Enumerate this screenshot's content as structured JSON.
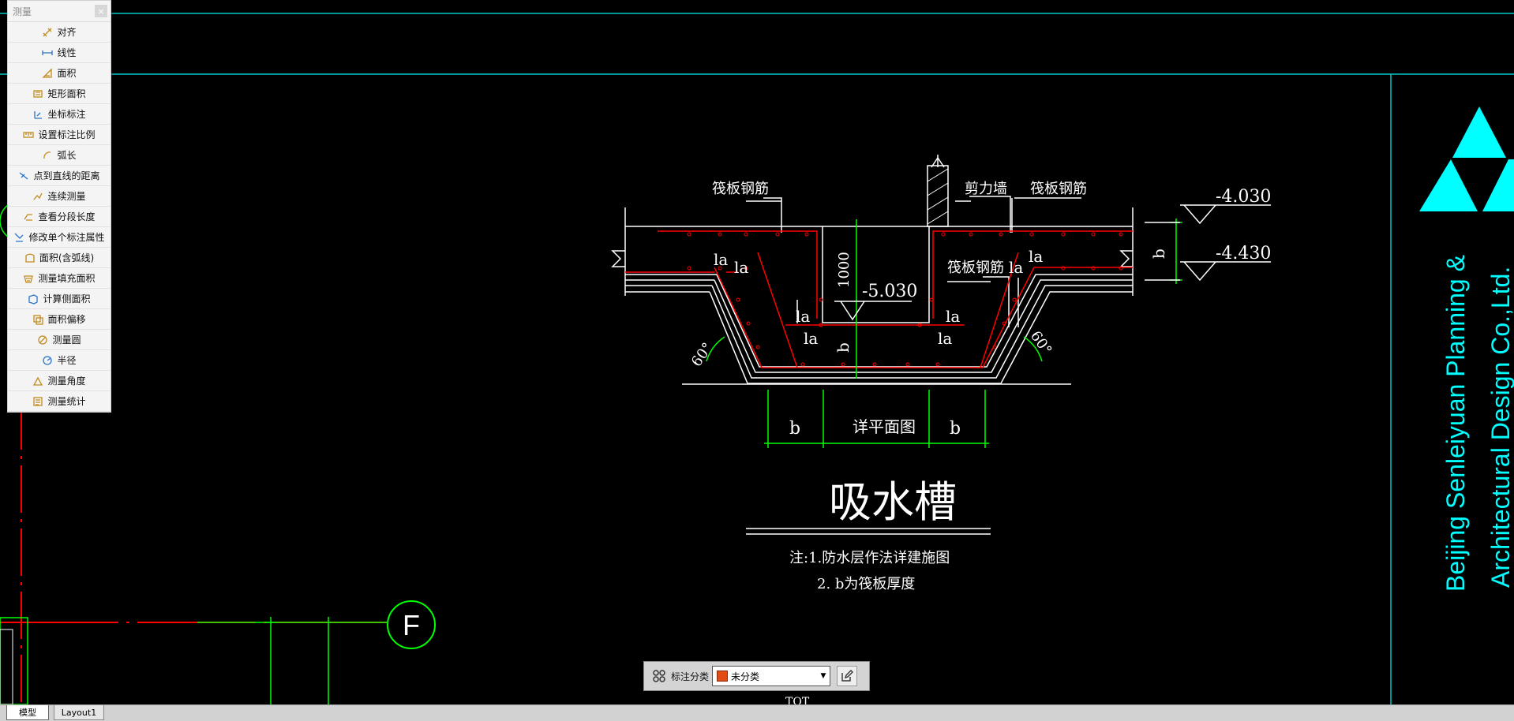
{
  "measure_panel": {
    "title": "测量",
    "close": "×",
    "items": [
      {
        "label": "对齐",
        "icon": "aligned-dim-icon"
      },
      {
        "label": "线性",
        "icon": "linear-dim-icon"
      },
      {
        "label": "面积",
        "icon": "area-icon"
      },
      {
        "label": "矩形面积",
        "icon": "rect-area-icon"
      },
      {
        "label": "坐标标注",
        "icon": "coord-dim-icon"
      },
      {
        "label": "设置标注比例",
        "icon": "dim-scale-icon"
      },
      {
        "label": "弧长",
        "icon": "arc-length-icon"
      },
      {
        "label": "点到直线的距离",
        "icon": "point-line-distance-icon"
      },
      {
        "label": "连续测量",
        "icon": "continuous-measure-icon"
      },
      {
        "label": "查看分段长度",
        "icon": "segment-length-icon"
      },
      {
        "label": "修改单个标注属性",
        "icon": "edit-dim-prop-icon"
      },
      {
        "label": "面积(含弧线)",
        "icon": "area-arc-icon"
      },
      {
        "label": "测量填充面积",
        "icon": "hatch-area-icon"
      },
      {
        "label": "计算侧面积",
        "icon": "side-area-icon"
      },
      {
        "label": "面积偏移",
        "icon": "area-offset-icon"
      },
      {
        "label": "测量圆",
        "icon": "measure-circle-icon"
      },
      {
        "label": "半径",
        "icon": "radius-icon"
      },
      {
        "label": "测量角度",
        "icon": "measure-angle-icon"
      },
      {
        "label": "测量统计",
        "icon": "measure-stats-icon"
      }
    ]
  },
  "drawing": {
    "label_raft_rebar_left": "筏板钢筋",
    "label_shear_wall": "剪力墙",
    "label_raft_rebar_right": "筏板钢筋",
    "label_raft_rebar_mid": "筏板钢筋",
    "elev_top": "-4.030",
    "elev_bottom": "-4.430",
    "elev_pit": "-5.030",
    "dim_1000": "1000",
    "la": "la",
    "b": "b",
    "angle": "60°",
    "plan_detail": "详平面图",
    "title": "吸水槽",
    "note_1": "注:1.防水层作法详建施图",
    "note_2": "2. b为筏板厚度",
    "axis_label": "F",
    "company_line1": "Beijing Senleiyuan Planning &",
    "company_line2": "Architectural Design Co.,Ltd.",
    "cursor_text": "TOT"
  },
  "dim_toolbar": {
    "label": "标注分类",
    "value": "未分类",
    "swatch_color": "#e34b14"
  },
  "tabs": {
    "model": "模型",
    "layout1": "Layout1"
  },
  "colors": {
    "background": "#000000",
    "line_white": "#ffffff",
    "line_red": "#ff0000",
    "line_green": "#00ff00",
    "line_cyan": "#00ffff",
    "logo_cyan": "#00ffff"
  }
}
